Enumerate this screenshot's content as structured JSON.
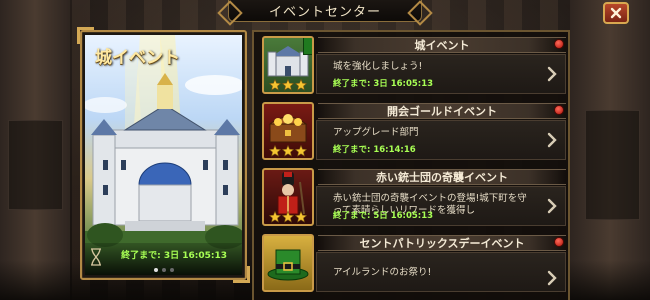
{
  "header": {
    "title": "イベントセンター",
    "close_icon": "close-icon"
  },
  "featured": {
    "title": "城イベント",
    "countdown": "終了まで: 3日 16:05:13",
    "page_count": 3,
    "active_page": 1
  },
  "events": [
    {
      "name": "城イベント",
      "description": "城を強化しましょう!",
      "time": "終了まで: 3日 16:05:13",
      "icon": "castle-icon",
      "stars": 3,
      "has_alert": true
    },
    {
      "name": "開会ゴールドイベント",
      "description": "アップグレード部門",
      "time": "終了まで: 16:14:16",
      "icon": "treasure-chest-icon",
      "stars": 3,
      "has_alert": true
    },
    {
      "name": "赤い銃士団の奇襲イベント",
      "description": "赤い銃士団の奇襲イベントの登場!城下町を守って素晴らしいリワードを獲得し",
      "time": "終了まで: 5日 16:05:13",
      "icon": "musketeer-icon",
      "stars": 3,
      "has_alert": false
    },
    {
      "name": "セントパトリックスデーイベント",
      "description": "アイルランドのお祭り!",
      "time": "",
      "icon": "leprechaun-hat-icon",
      "stars": 0,
      "has_alert": true
    }
  ],
  "colors": {
    "gold": "#b38a45",
    "timer_green": "#a8ff54",
    "alert_red": "#c0180c"
  }
}
